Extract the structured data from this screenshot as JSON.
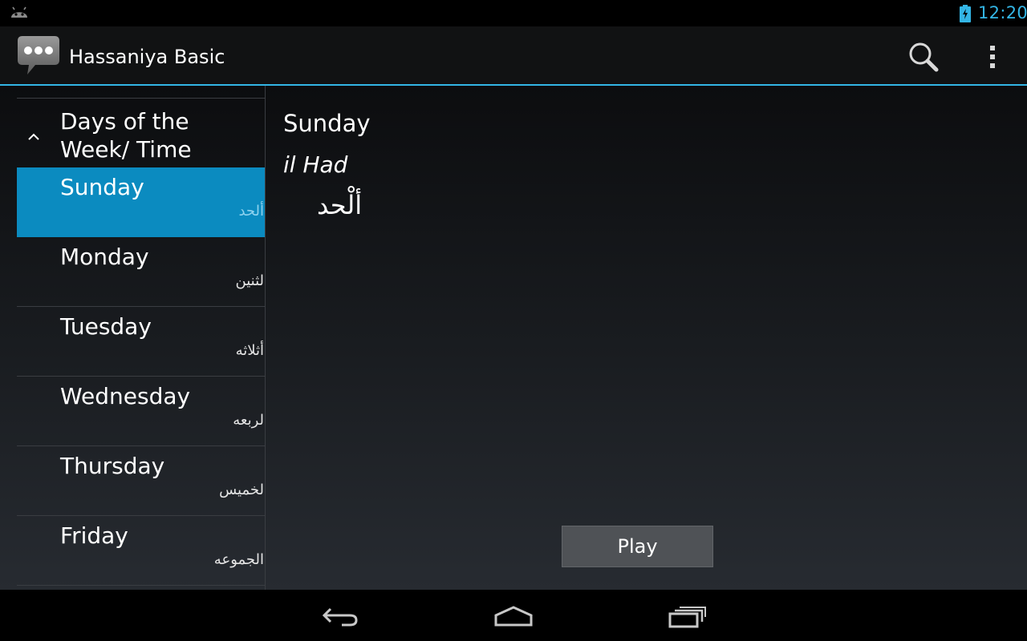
{
  "status_bar": {
    "time": "12:20",
    "icons": [
      "android-icon",
      "battery-charging-icon"
    ],
    "accent_color": "#33b5e5"
  },
  "action_bar": {
    "title": "Hassaniya Basic",
    "app_icon": "speech-bubble-icon",
    "actions": [
      "search-icon",
      "overflow-menu-icon"
    ]
  },
  "sidebar": {
    "group": {
      "title": "Days of the Week/ Time",
      "icon": "chevron-up-icon",
      "expanded": true
    },
    "items": [
      {
        "label": "Sunday",
        "arabic": "ألحد",
        "selected": true
      },
      {
        "label": "Monday",
        "arabic": "لثنين",
        "selected": false
      },
      {
        "label": "Tuesday",
        "arabic": "أثلاثه",
        "selected": false
      },
      {
        "label": "Wednesday",
        "arabic": "لربعه",
        "selected": false
      },
      {
        "label": "Thursday",
        "arabic": "لخميس",
        "selected": false
      },
      {
        "label": "Friday",
        "arabic": "الجموعه",
        "selected": false
      }
    ],
    "selected_color": "#0b8bc0"
  },
  "detail": {
    "english": "Sunday",
    "transliteration": "il Had",
    "arabic": "ألْحد",
    "play_label": "Play"
  },
  "nav_bar": {
    "buttons": [
      "back-icon",
      "home-icon",
      "recent-apps-icon"
    ]
  }
}
